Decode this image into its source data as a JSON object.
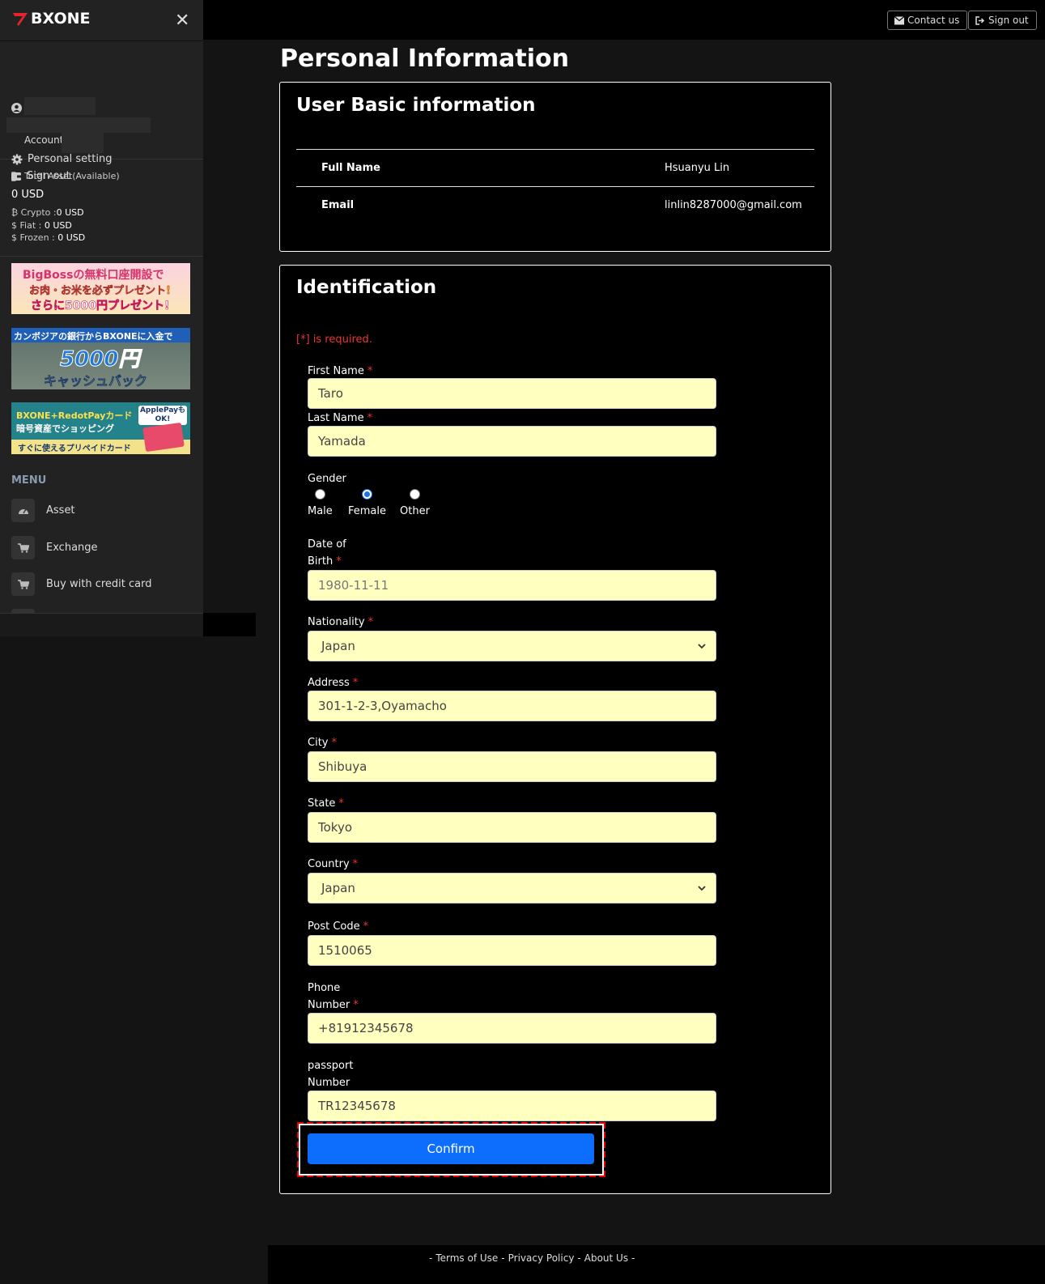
{
  "brand": {
    "name": "BXONE"
  },
  "topbar": {
    "contact_label": "Contact us",
    "signout_label": "Sign out"
  },
  "sidebar": {
    "account_label": "Account:",
    "personal_setting": "Personal setting",
    "sign_out": "Sign out",
    "total_asset_label": "Total Asset(Available)",
    "total_asset_value": "0 USD",
    "crypto_label": "Crypto :",
    "crypto_value": "0 USD",
    "fiat_label": "Fiat :",
    "fiat_value": "0 USD",
    "frozen_label": "Frozen :",
    "frozen_value": "0 USD",
    "banners": [
      {
        "line1": "BigBossの無料口座開設で",
        "line2": "お肉・お米を必ずプレゼント!",
        "line3": "さらに5000円プレゼント!"
      },
      {
        "line1": "カンボジアの銀行からBXONEに入金で",
        "line2": "5000円",
        "line3": "キャッシュバック"
      },
      {
        "line1": "BXONE+RedotPayカード",
        "line2": "暗号資産でショッピング",
        "line3": "すぐに使えるプリペイドカード",
        "badge": "ApplePayも OK!"
      }
    ],
    "menu_title": "MENU",
    "menu": [
      {
        "label": "Asset",
        "icon": "dashboard-icon"
      },
      {
        "label": "Exchange",
        "icon": "cart-icon"
      },
      {
        "label": "Buy with credit card",
        "icon": "cart-icon"
      }
    ]
  },
  "page": {
    "title": "Personal Information"
  },
  "basic": {
    "heading": "User Basic information",
    "rows": [
      {
        "key": "Full Name",
        "value": "Hsuanyu Lin"
      },
      {
        "key": "Email",
        "value": "linlin8287000@gmail.com"
      }
    ]
  },
  "ident": {
    "heading": "Identification",
    "required_note": "[*] is required.",
    "first_name": {
      "label": "First Name",
      "value": "Taro"
    },
    "last_name": {
      "label": "Last Name",
      "value": "Yamada"
    },
    "gender": {
      "label": "Gender",
      "options": [
        "Male",
        "Female",
        "Other"
      ],
      "selected": "Female"
    },
    "dob": {
      "label1": "Date of",
      "label2": "Birth",
      "placeholder": "1980-11-11"
    },
    "nationality": {
      "label": "Nationality",
      "value": "Japan"
    },
    "address": {
      "label": "Address",
      "value": "301-1-2-3,Oyamacho"
    },
    "city": {
      "label": "City",
      "value": "Shibuya"
    },
    "state": {
      "label": "State",
      "value": "Tokyo"
    },
    "country": {
      "label": "Country",
      "value": "Japan"
    },
    "post_code": {
      "label": "Post Code",
      "value": "1510065"
    },
    "phone": {
      "label1": "Phone",
      "label2": "Number",
      "value": "+81912345678"
    },
    "passport": {
      "label1": "passport",
      "label2": "Number",
      "value": "TR12345678"
    },
    "confirm_label": "Confirm",
    "required_mark": "*"
  },
  "footer": {
    "terms": "Terms of Use",
    "privacy": "Privacy Policy",
    "about": "About Us",
    "sep": "-"
  },
  "colors": {
    "accent": "#0d6efd",
    "input_bg": "#ffffc0",
    "required": "#e33",
    "focus_border": "#e00"
  }
}
